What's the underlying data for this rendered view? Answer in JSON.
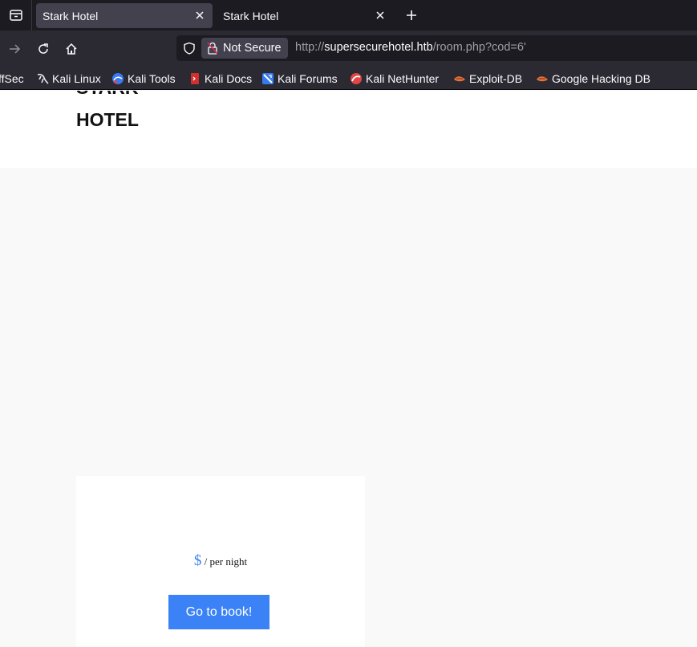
{
  "browser": {
    "tabs": [
      {
        "title": "Stark Hotel",
        "active": true
      },
      {
        "title": "Stark Hotel",
        "active": false
      }
    ],
    "security_label": "Not Secure",
    "url": {
      "scheme": "http://",
      "host": "supersecurehotel.htb",
      "path": "/room.php?cod=6'"
    },
    "bookmarks": [
      {
        "label": "ffSec",
        "icon": "offsec-icon"
      },
      {
        "label": "Kali Linux",
        "icon": "kali-dragon-icon"
      },
      {
        "label": "Kali Tools",
        "icon": "kali-tools-icon"
      },
      {
        "label": "Kali Docs",
        "icon": "kali-docs-icon"
      },
      {
        "label": "Kali Forums",
        "icon": "kali-forums-icon"
      },
      {
        "label": "Kali NetHunter",
        "icon": "kali-nethunter-icon"
      },
      {
        "label": "Exploit-DB",
        "icon": "exploit-db-icon"
      },
      {
        "label": "Google Hacking DB",
        "icon": "ghdb-icon"
      }
    ]
  },
  "page": {
    "logo_line1": "STARK",
    "logo_line2": "HOTEL",
    "room": {
      "currency": "$",
      "per_night": " / per night",
      "book_label": "Go to book!"
    }
  },
  "colors": {
    "accent": "#3b82f6",
    "chrome_dark": "#1c1b22",
    "chrome": "#2b2a33",
    "active_tab": "#42414d"
  }
}
